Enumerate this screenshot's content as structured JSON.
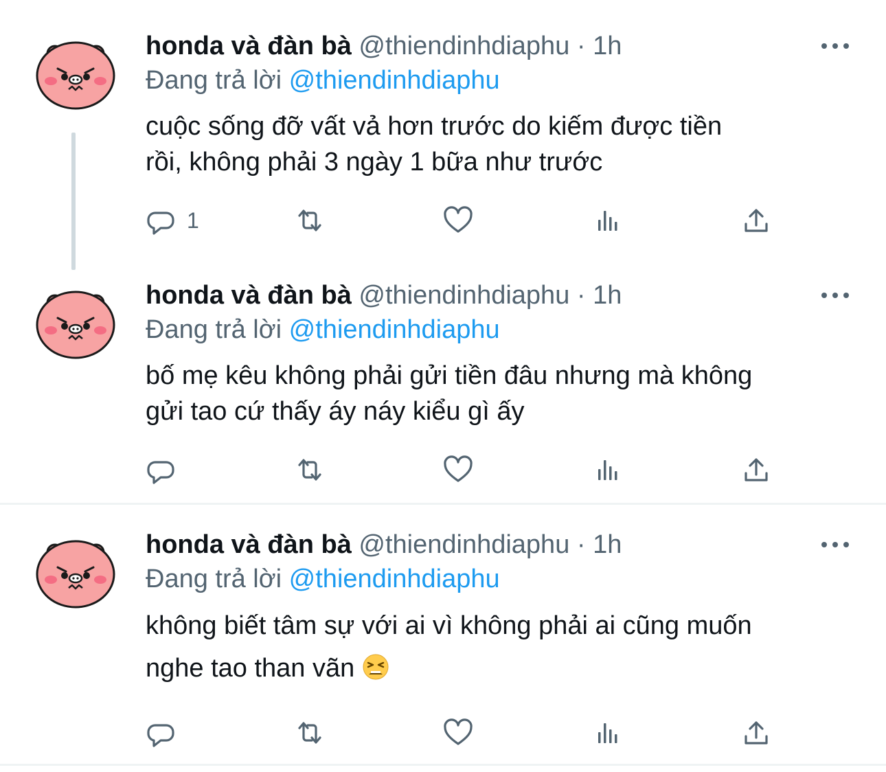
{
  "tweets": [
    {
      "author_name": "honda và đàn bà",
      "handle": "@thiendinhdiaphu",
      "separator": "·",
      "time": "1h",
      "reply_prefix": "Đang trả lời",
      "reply_to": "@thiendinhdiaphu",
      "text_lines": [
        "cuộc sống đỡ vất vả hơn trước do kiếm được tiền",
        "rồi, không phải 3 ngày 1 bữa như trước"
      ],
      "reply_count": "1"
    },
    {
      "author_name": "honda và đàn bà",
      "handle": "@thiendinhdiaphu",
      "separator": "·",
      "time": "1h",
      "reply_prefix": "Đang trả lời",
      "reply_to": "@thiendinhdiaphu",
      "text_lines": [
        "bố mẹ kêu không phải gửi tiền đâu nhưng mà không",
        "gửi tao cứ thấy áy náy kiểu gì ấy"
      ],
      "reply_count": ""
    },
    {
      "author_name": "honda và đàn bà",
      "handle": "@thiendinhdiaphu",
      "separator": "·",
      "time": "1h",
      "reply_prefix": "Đang trả lời",
      "reply_to": "@thiendinhdiaphu",
      "text_lines": [
        "không biết tâm sự với ai vì không phải ai cũng muốn",
        "nghe tao than vãn"
      ],
      "emoji_icon": "tired-face-emoji-icon",
      "reply_count": ""
    }
  ],
  "colors": {
    "text": "#0f1419",
    "secondary": "#536471",
    "accent": "#1d9bf0",
    "divider": "#eff3f4",
    "thread_line": "#cfd9de"
  },
  "icons": [
    "reply-icon",
    "retweet-icon",
    "like-icon",
    "views-icon",
    "share-icon",
    "more-icon",
    "avatar-pig-icon"
  ]
}
